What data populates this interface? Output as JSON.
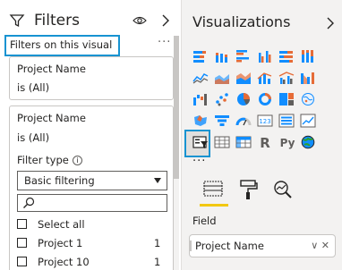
{
  "filters": {
    "title": "Filters",
    "section_label": "Filters on this visual",
    "more_glyph": "···",
    "card1": {
      "field": "Project Name",
      "condition": "is (All)"
    },
    "card2": {
      "field": "Project Name",
      "condition": "is (All)",
      "filter_type_label": "Filter type",
      "filter_type_value": "Basic filtering",
      "options": [
        {
          "label": "Select all",
          "count": ""
        },
        {
          "label": "Project 1",
          "count": "1"
        },
        {
          "label": "Project 10",
          "count": "1"
        }
      ]
    }
  },
  "visualizations": {
    "title": "Visualizations",
    "more_glyph": "···",
    "field_label": "Field",
    "field_value": "Project Name",
    "icons": [
      "stacked-bar-chart-icon",
      "stacked-column-chart-icon",
      "clustered-bar-chart-icon",
      "clustered-column-chart-icon",
      "100-stacked-bar-icon",
      "100-stacked-column-icon",
      "line-chart-icon",
      "area-chart-icon",
      "stacked-area-chart-icon",
      "line-and-column-chart-icon",
      "line-and-clustered-column-icon",
      "ribbon-chart-icon",
      "waterfall-chart-icon",
      "scatter-chart-icon",
      "pie-chart-icon",
      "donut-chart-icon",
      "treemap-icon",
      "map-icon",
      "filled-map-icon",
      "funnel-chart-icon",
      "gauge-icon",
      "card-icon",
      "multi-row-card-icon",
      "kpi-icon",
      "slicer-icon",
      "table-icon",
      "matrix-icon",
      "r-visual-icon",
      "python-visual-icon",
      "globe-icon"
    ]
  },
  "colors": {
    "accent_blue": "#1793d1",
    "accent_yellow": "#f2c811",
    "icon_blue": "#118dff",
    "icon_orange": "#e66c37",
    "icon_gray": "#605e5c"
  }
}
